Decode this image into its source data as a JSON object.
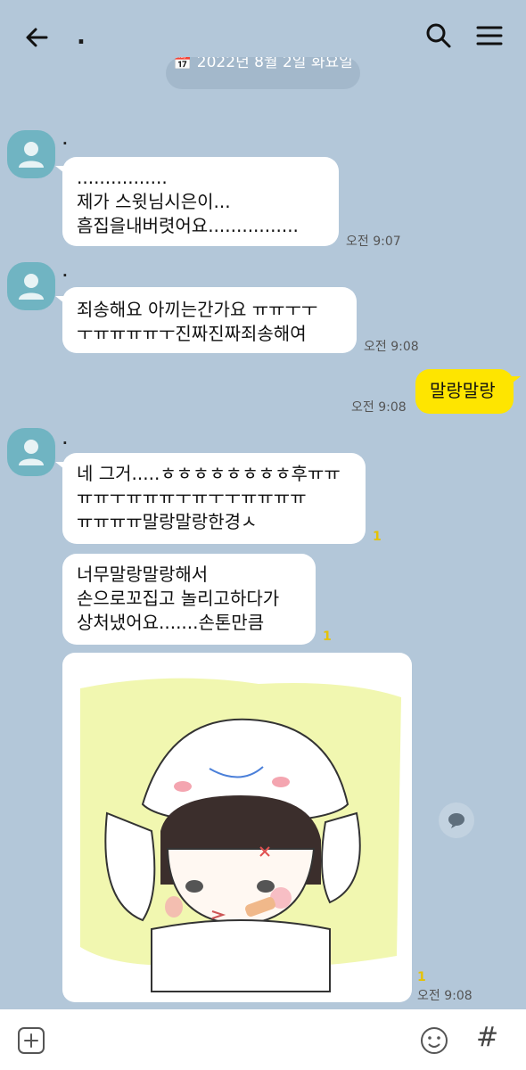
{
  "header": {
    "room_title": ".",
    "back_icon": "arrow-left-icon",
    "search_icon": "search-icon",
    "menu_icon": "menu-icon"
  },
  "date_divider": "📅 2022년 8월 2일 화요일",
  "messages": [
    {
      "sender": ".",
      "text": "................\n제가 스윗님시은이...\n흠집을내버렷어요................",
      "time": "오전 9:07"
    },
    {
      "sender": ".",
      "text": "죄송해요 아끼는간가요 ㅠㅠㅜㅜ\nㅜㅠㅠㅠㅠㅜ진짜진짜죄송해여",
      "time": "오전 9:08"
    },
    {
      "sender": "me",
      "text": "말랑말랑",
      "time": "오전 9:08"
    },
    {
      "sender": ".",
      "text": "네 그거.....ㅎㅎㅎㅎㅎㅎㅎㅎ후ㅠㅠ\nㅠㅠㅜㅠㅠㅠㅜㅠㅜㅜㅠㅠㅠㅠ\nㅠㅠㅠㅠ말랑말랑한경ㅅ",
      "unread": "1"
    },
    {
      "text": "너무말랑말랑해서\n손으로꼬집고 놀리고하다가\n상처냈어요.......손톤만큼",
      "unread": "1"
    },
    {
      "type": "image",
      "unread": "1",
      "time": "오전 9:08"
    }
  ],
  "colors": {
    "background": "#b3c7d9",
    "my_bubble": "#fee500",
    "their_bubble": "#ffffff",
    "avatar": "#70b4c2",
    "unread": "#e6c200"
  },
  "bottom_bar": {
    "add_icon": "plus-square-icon",
    "emoji_icon": "emoji-icon",
    "hash_label": "#"
  }
}
